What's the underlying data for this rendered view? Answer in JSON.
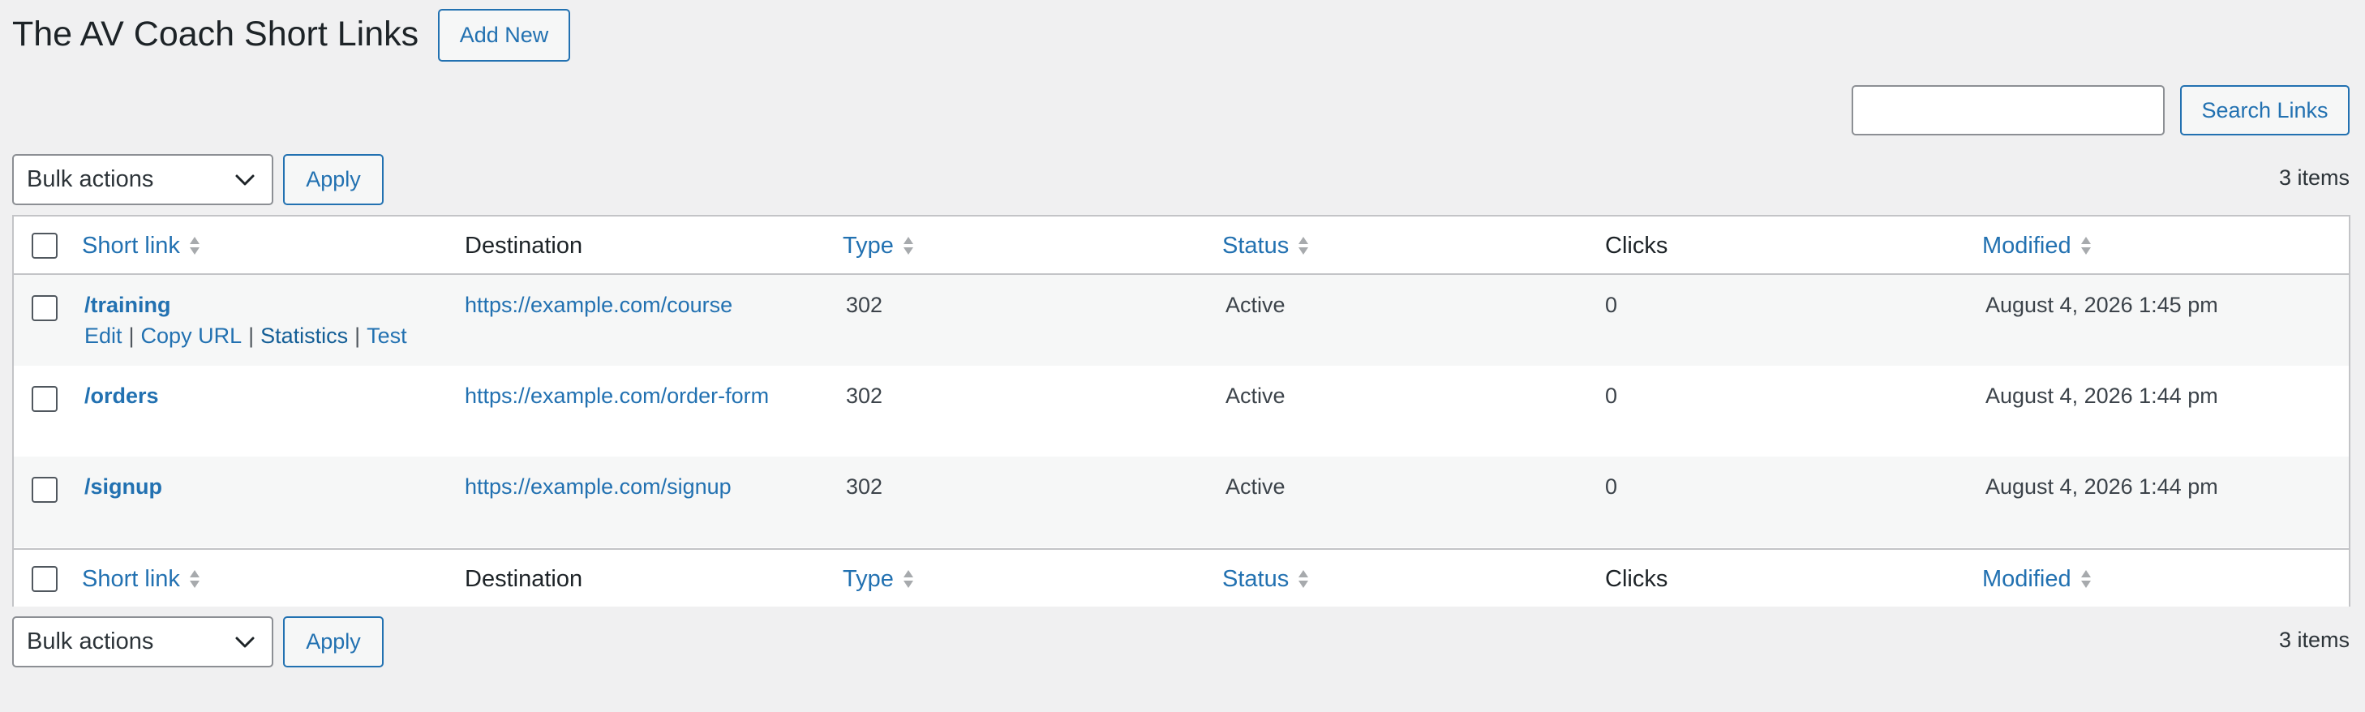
{
  "header": {
    "title": "The AV Coach Short Links",
    "add_new_label": "Add New"
  },
  "search": {
    "value": "",
    "button_label": "Search Links"
  },
  "bulk": {
    "selected": "Bulk actions",
    "apply_label": "Apply",
    "items_count": "3 items"
  },
  "table": {
    "columns": {
      "short_link": "Short link",
      "destination": "Destination",
      "type": "Type",
      "status": "Status",
      "clicks": "Clicks",
      "modified": "Modified"
    },
    "row_actions": {
      "edit": "Edit",
      "copy_url": "Copy URL",
      "statistics": "Statistics",
      "test": "Test",
      "separator": "|"
    },
    "rows": [
      {
        "short_link": "/training",
        "destination": "https://example.com/course",
        "type": "302",
        "status": "Active",
        "clicks": "0",
        "modified": "August 4, 2026 1:45 pm"
      },
      {
        "short_link": "/orders",
        "destination": "https://example.com/order-form",
        "type": "302",
        "status": "Active",
        "clicks": "0",
        "modified": "August 4, 2026 1:44 pm"
      },
      {
        "short_link": "/signup",
        "destination": "https://example.com/signup",
        "type": "302",
        "status": "Active",
        "clicks": "0",
        "modified": "August 4, 2026 1:44 pm"
      }
    ]
  },
  "colors": {
    "accent": "#2271b1",
    "background": "#f0f0f1",
    "border": "#c3c4c7",
    "row_alt": "#f6f7f7"
  },
  "icons": {
    "sort": "sort-arrows-icon",
    "dropdown": "chevron-down-icon"
  }
}
